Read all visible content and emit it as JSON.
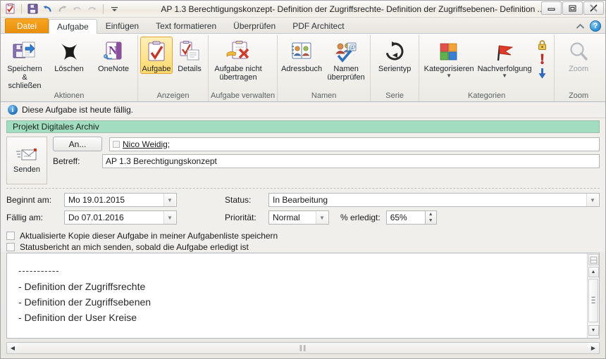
{
  "window": {
    "title": "AP 1.3 Berechtigungskonzept- Definition der Zugriffsrechte- Definition der Zugriffsebenen- Definition ...",
    "minimize_label": "–",
    "maximize_label": "❐",
    "close_label": "✕"
  },
  "quick_access": {
    "items": [
      {
        "name": "task-icon",
        "label": ""
      },
      {
        "name": "save-icon",
        "label": ""
      },
      {
        "name": "undo-icon",
        "label": ""
      },
      {
        "name": "redo-icon",
        "label": ""
      },
      {
        "name": "previous-item-icon",
        "label": ""
      },
      {
        "name": "next-item-icon",
        "label": ""
      },
      {
        "name": "customize-qat-icon",
        "label": ""
      }
    ]
  },
  "tabs": [
    {
      "label": "Datei",
      "type": "file",
      "active": false
    },
    {
      "label": "Aufgabe",
      "type": "normal",
      "active": true
    },
    {
      "label": "Einfügen",
      "type": "normal",
      "active": false
    },
    {
      "label": "Text formatieren",
      "type": "normal",
      "active": false
    },
    {
      "label": "Überprüfen",
      "type": "normal",
      "active": false
    },
    {
      "label": "PDF Architect",
      "type": "normal",
      "active": false
    }
  ],
  "tab_right": {
    "collapse_ribbon": "⌃",
    "help": "?"
  },
  "ribbon": {
    "groups": [
      {
        "label": "Aktionen",
        "commands": [
          {
            "label": "Speichern\n& schließen",
            "line1": "Speichern",
            "line2": "& schließen",
            "icon": "save-close-icon",
            "selected": false
          },
          {
            "label": "Löschen",
            "line1": "Löschen",
            "line2": "",
            "icon": "delete-x-icon",
            "selected": false
          },
          {
            "label": "OneNote",
            "line1": "OneNote",
            "line2": "",
            "icon": "onenote-icon",
            "selected": false
          }
        ]
      },
      {
        "label": "Anzeigen",
        "commands": [
          {
            "label": "Aufgabe",
            "line1": "Aufgabe",
            "line2": "",
            "icon": "task-clipboard-icon",
            "selected": true
          },
          {
            "label": "Details",
            "line1": "Details",
            "line2": "",
            "icon": "details-clipboard-icon",
            "selected": false
          }
        ]
      },
      {
        "label": "Aufgabe verwalten",
        "commands": [
          {
            "label": "Aufgabe nicht übertragen",
            "line1": "Aufgabe nicht",
            "line2": "übertragen",
            "icon": "task-cancel-icon",
            "selected": false
          }
        ]
      },
      {
        "label": "Namen",
        "commands": [
          {
            "label": "Adressbuch",
            "line1": "Adressbuch",
            "line2": "",
            "icon": "address-book-icon",
            "selected": false
          },
          {
            "label": "Namen überprüfen",
            "line1": "Namen",
            "line2": "überprüfen",
            "icon": "check-names-icon",
            "selected": false
          }
        ]
      },
      {
        "label": "Serie",
        "commands": [
          {
            "label": "Serientyp",
            "line1": "Serientyp",
            "line2": "",
            "icon": "recurrence-icon",
            "selected": false
          }
        ]
      },
      {
        "label": "Kategorien",
        "commands": [
          {
            "label": "Kategorisieren",
            "line1": "Kategorisieren",
            "line2": "",
            "icon": "categorize-icon",
            "selected": false,
            "has_dropdown": true
          },
          {
            "label": "Nachverfolgung",
            "line1": "Nachverfolgung",
            "line2": "",
            "icon": "follow-up-flag-icon",
            "selected": false,
            "has_dropdown": true
          }
        ],
        "small_icons": [
          {
            "name": "private-lock-icon",
            "label": "Privat"
          },
          {
            "name": "high-importance-icon",
            "label": "Hohe Wichtigkeit"
          },
          {
            "name": "low-importance-icon",
            "label": "Niedrige Wichtigkeit"
          }
        ]
      },
      {
        "label": "Zoom",
        "commands": [
          {
            "label": "Zoom",
            "line1": "Zoom",
            "line2": "",
            "icon": "zoom-magnifier-icon",
            "selected": false,
            "dim": true
          }
        ]
      }
    ]
  },
  "info_bar": {
    "icon": "info-icon",
    "text": "Diese Aufgabe ist heute fällig."
  },
  "category_banner": {
    "text": "Projekt Digitales Archiv",
    "color": "#a3ddc0"
  },
  "header": {
    "send_button": "Senden",
    "send_icon": "send-envelope-icon",
    "to_button": "An...",
    "to_value": "Nico Weidig;",
    "subject_label": "Betreff:",
    "subject_value": "AP 1.3 Berechtigungskonzept"
  },
  "fields": {
    "start_label": "Beginnt am:",
    "start_value": "Mo 19.01.2015",
    "due_label": "Fällig am:",
    "due_value": "Do 07.01.2016",
    "status_label": "Status:",
    "status_value": "In Bearbeitung",
    "priority_label": "Priorität:",
    "priority_value": "Normal",
    "percent_label": "% erledigt:",
    "percent_value": "65%"
  },
  "checkboxes": [
    {
      "label": "Aktualisierte Kopie dieser Aufgabe in meiner Aufgabenliste speichern",
      "checked": false
    },
    {
      "label": "Statusbericht an mich senden, sobald die Aufgabe erledigt ist",
      "checked": false
    }
  ],
  "body": {
    "separator": "-----------",
    "lines": [
      "- Definition der Zugriffsrechte",
      "- Definition der Zugriffsebenen",
      "- Definition der User Kreise"
    ]
  },
  "scrollbars": {
    "up_arrow": "▲",
    "down_arrow": "▼",
    "left_arrow": "◀",
    "right_arrow": "▶",
    "grip_v": "‖",
    "grip_h": "≡"
  }
}
